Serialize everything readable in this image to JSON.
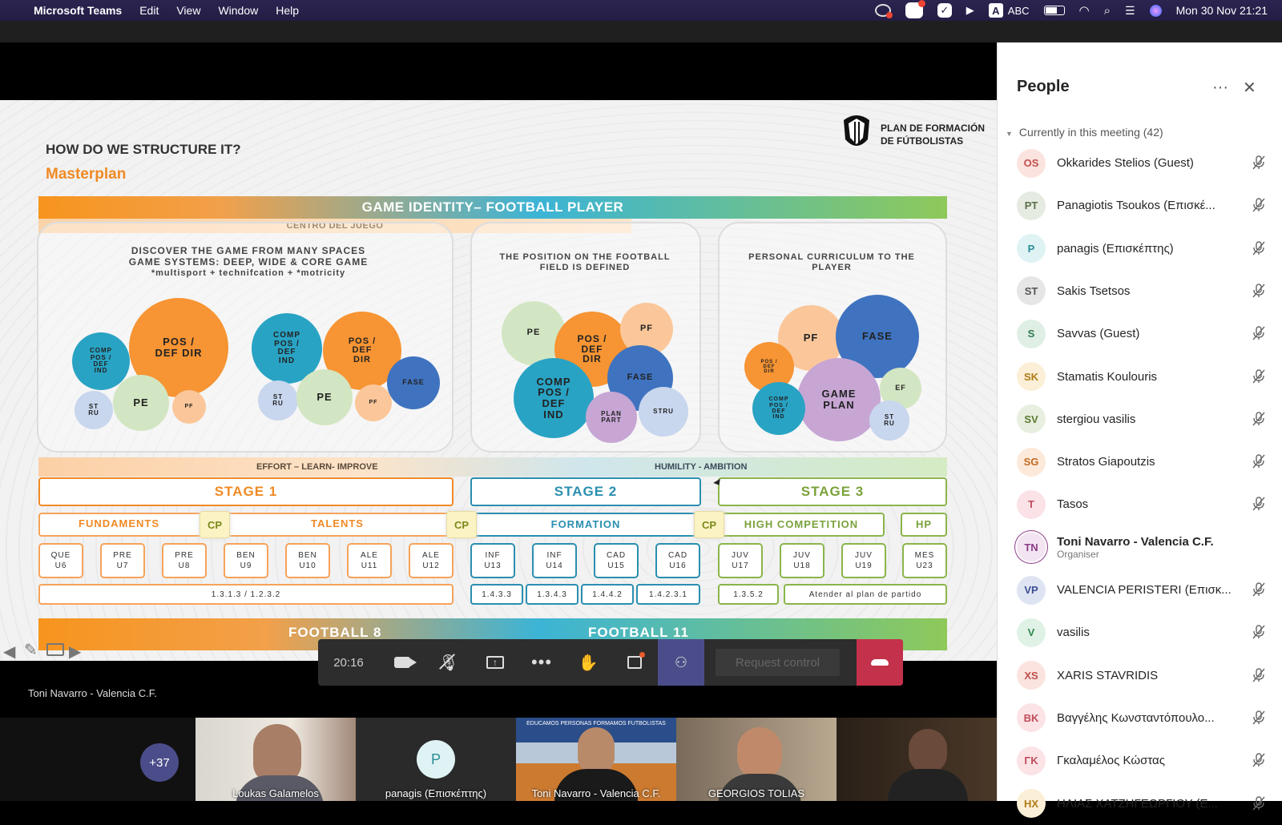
{
  "menubar": {
    "apple": "",
    "app": "Microsoft Teams",
    "items": [
      "Edit",
      "View",
      "Window",
      "Help"
    ],
    "keyboard": "ABC",
    "keyboard_badge": "A",
    "datetime": "Mon 30 Nov  21:21"
  },
  "slide": {
    "title": "HOW DO WE STRUCTURE IT?",
    "subtitle": "Masterplan",
    "logo_text_1": "PLAN DE FORMACIÓN",
    "logo_text_2": "DE FÚTBOLISTAS",
    "game_identity": "GAME IDENTITY– FOOTBALL PLAYER",
    "centro": "CENTRO DEL JUEGO",
    "p1_line1": "DISCOVER THE GAME FROM MANY SPACES",
    "p1_line2": "GAME SYSTEMS: DEEP, WIDE & CORE GAME",
    "p1_line3": "*multisport + technifcation + *motricity",
    "p2_text": "THE POSITION ON THE FOOTBALL FIELD IS DEFINED",
    "p3_text": "PERSONAL CURRICULUM TO THE PLAYER",
    "effort": "EFFORT – LEARN-  IMPROVE",
    "humility": "HUMILITY - AMBITION",
    "stage1": "STAGE 1",
    "stage2": "STAGE 2",
    "stage3": "STAGE 3",
    "fundaments": "FUNDAMENTS",
    "talents": "TALENTS",
    "formation": "FORMATION",
    "high_competition": "HIGH COMPETITION",
    "hp": "HP",
    "cp": "CP",
    "ages": [
      "QUE\nU6",
      "PRE\nU7",
      "PRE\nU8",
      "BEN\nU9",
      "BEN\nU10",
      "ALE\nU11",
      "ALE\nU12",
      "INF\nU13",
      "INF\nU14",
      "CAD\nU15",
      "CAD\nU16",
      "JUV\nU17",
      "JUV\nU18",
      "JUV\nU19",
      "MES\nU23"
    ],
    "codes": [
      "1.3.1.3  /  1.2.3.2",
      "1.4.3.3",
      "1.3.4.3",
      "1.4.4.2",
      "1.4.2.3.1",
      "1.3.5.2",
      "Atender al plan de partido"
    ],
    "football8": "FOOTBALL 8",
    "football11": "FOOTBALL 11",
    "bubbles": {
      "comp_small": "COMP\nPOS /\nDEF\nIND",
      "pos_def_dir": "POS /\nDEF DIR",
      "stru": "ST\nRU",
      "pe": "PE",
      "pf": "PF",
      "comp": "COMP\nPOS /\nDEF\nIND",
      "pos_def_dir2": "POS /\nDEF\nDIR",
      "fase": "FASE",
      "comp_big": "COMP\nPOS /\nDEF\nIND",
      "plan_part": "PLAN\nPART",
      "stru2": "STRU",
      "game_plan": "GAME\nPLAN",
      "ef": "EF"
    }
  },
  "controls": {
    "timer": "20:16",
    "request_control": "Request control"
  },
  "presenter_label": "Toni Navarro - Valencia C.F.",
  "tiles": {
    "overflow": "+37",
    "t1": "Loukas Galamelos",
    "t2": "panagis (Επισκέπτης)",
    "t2_initial": "P",
    "t3": "Toni Navarro - Valencia C.F.",
    "t3_banner": "EDUCAMOS PERSONAS   FORMAMOS FUTBOLISTAS",
    "t4": "GEORGIOS TOLIAS"
  },
  "people": {
    "title": "People",
    "section": "Currently in this meeting (42)",
    "list": [
      {
        "initials": "OS",
        "name": "Okkarides Stelios (Guest)",
        "bg": "#fbe3df",
        "fg": "#c0504d"
      },
      {
        "initials": "PT",
        "name": "Panagiotis Tsoukos (Επισκέ...",
        "bg": "#e6ebe2",
        "fg": "#5b6f4a"
      },
      {
        "initials": "P",
        "name": "panagis (Επισκέπτης)",
        "bg": "#dff3f4",
        "fg": "#2a8c96"
      },
      {
        "initials": "ST",
        "name": "Sakis Tsetsos",
        "bg": "#e6e6e6",
        "fg": "#555"
      },
      {
        "initials": "S",
        "name": "Savvas (Guest)",
        "bg": "#e0efe6",
        "fg": "#2f7a4e"
      },
      {
        "initials": "SK",
        "name": "Stamatis Koulouris",
        "bg": "#fbefd7",
        "fg": "#b07a16"
      },
      {
        "initials": "SV",
        "name": "stergiou vasilis",
        "bg": "#e8efe0",
        "fg": "#5a7a2f"
      },
      {
        "initials": "SG",
        "name": "Stratos Giapoutzis",
        "bg": "#fde9d9",
        "fg": "#c06a22"
      },
      {
        "initials": "T",
        "name": "Tasos",
        "bg": "#fbe2e6",
        "fg": "#c04d62"
      },
      {
        "initials": "TN",
        "name": "Toni Navarro - Valencia C.F.",
        "sub": "Organiser",
        "bg": "#f3e4f2",
        "fg": "#8a3c86"
      },
      {
        "initials": "VP",
        "name": "VALENCIA PERISTERI (Επισκ...",
        "bg": "#dfe4f3",
        "fg": "#3a4f94"
      },
      {
        "initials": "V",
        "name": "vasilis",
        "bg": "#e0f2e6",
        "fg": "#2f8a4e"
      },
      {
        "initials": "XS",
        "name": "XARIS STAVRIDIS",
        "bg": "#fbe3df",
        "fg": "#c0504d"
      },
      {
        "initials": "BK",
        "name": "Βαγγέλης Κωνσταντόπουλο...",
        "bg": "#fbe3e6",
        "fg": "#c04d5a"
      },
      {
        "initials": "ΓΚ",
        "name": "Γκαλαμέλος Κώστας",
        "bg": "#fbe3e6",
        "fg": "#c04d5a"
      },
      {
        "initials": "ΗΧ",
        "name": "ΗΛΙΑΣ ΧΑΤΖΗΓΕΩΡΓΙΟΥ (Ε...",
        "bg": "#fbefd7",
        "fg": "#b07a16"
      }
    ]
  }
}
